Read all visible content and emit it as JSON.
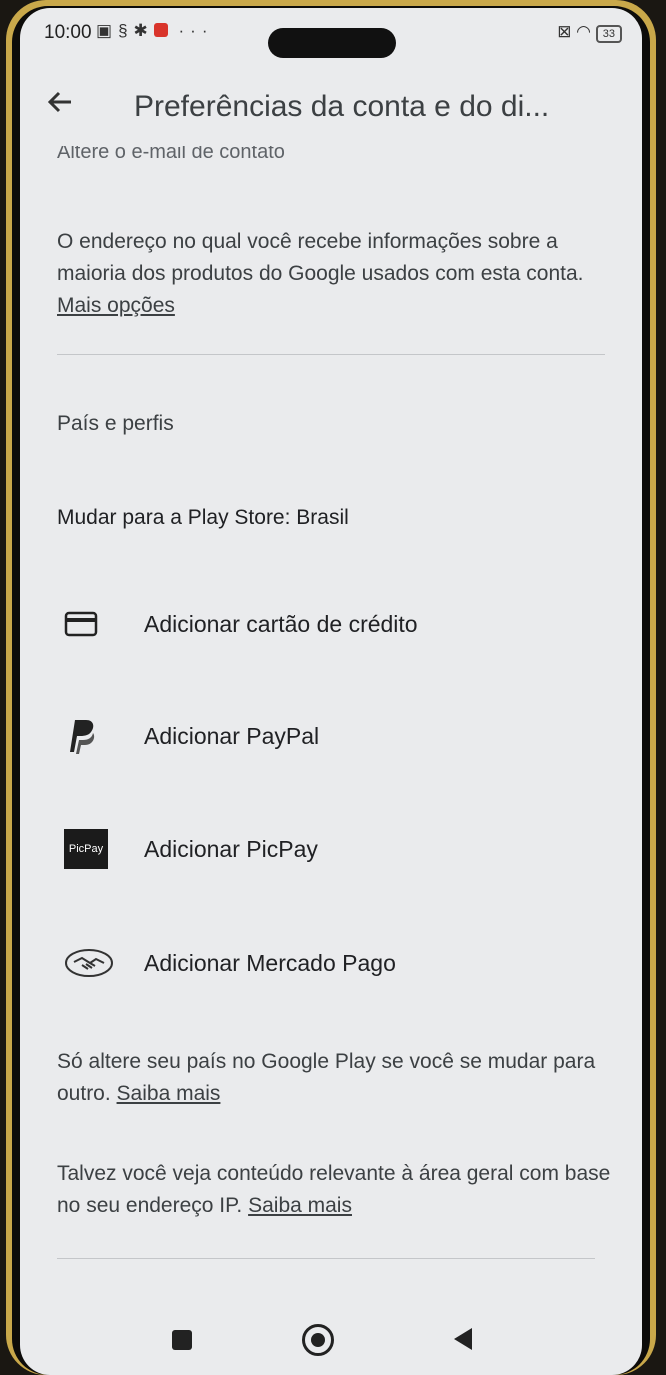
{
  "status_bar": {
    "time": "10:00",
    "battery": "33"
  },
  "header": {
    "back_icon": "arrow-left-icon",
    "title": "Preferências da conta e do di..."
  },
  "clipped_text": "Altere o e-mail de contato",
  "email_section": {
    "description": "O endereço no qual você recebe informações sobre a maioria dos produtos do Google usados com esta conta. ",
    "link": "Mais opções"
  },
  "country_section": {
    "heading": "País e perfis",
    "switch_store": "Mudar para a Play Store: Brasil",
    "payment_options": [
      {
        "icon": "credit-card-icon",
        "label": "Adicionar cartão de crédito"
      },
      {
        "icon": "paypal-icon",
        "label": "Adicionar PayPal"
      },
      {
        "icon": "picpay-icon",
        "label": "Adicionar PicPay",
        "icon_text": "PicPay"
      },
      {
        "icon": "mercado-pago-icon",
        "label": "Adicionar Mercado Pago"
      }
    ],
    "note": {
      "text": "Só altere seu país no Google Play se você se mudar para outro. ",
      "link": "Saiba mais"
    },
    "ip_note": {
      "text": "Talvez você veja conteúdo relevante à área geral com base no seu endereço IP. ",
      "link": "Saiba mais"
    }
  },
  "nav_bar": {
    "recents": "recents-button",
    "home": "home-button",
    "back": "back-button"
  }
}
